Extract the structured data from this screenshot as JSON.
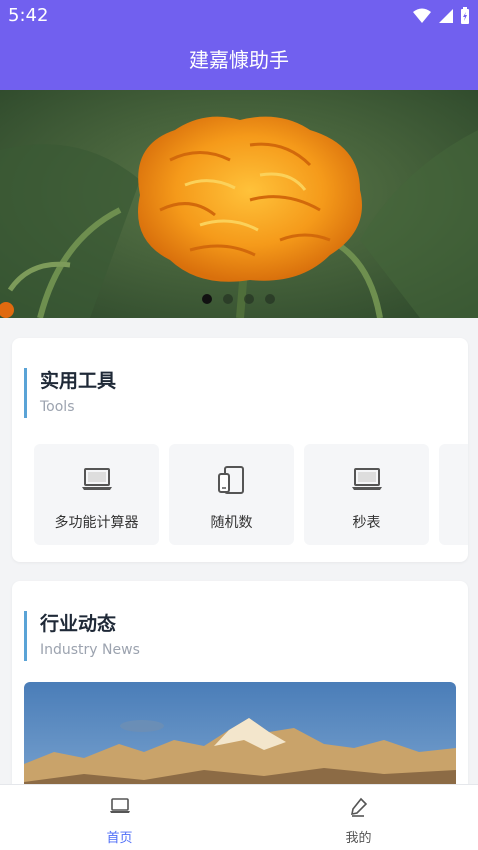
{
  "status_bar": {
    "time": "5:42"
  },
  "header": {
    "title": "建嘉慷助手"
  },
  "banner": {
    "slides": 4,
    "active_index": 0
  },
  "tools_section": {
    "title": "实用工具",
    "subtitle": "Tools",
    "items": [
      {
        "label": "多功能计算器",
        "icon": "laptop-icon"
      },
      {
        "label": "随机数",
        "icon": "devices-icon"
      },
      {
        "label": "秒表",
        "icon": "laptop-icon"
      }
    ]
  },
  "news_section": {
    "title": "行业动态",
    "subtitle": "Industry News"
  },
  "tabbar": {
    "items": [
      {
        "label": "首页",
        "icon": "laptop-icon",
        "active": true
      },
      {
        "label": "我的",
        "icon": "pen-icon",
        "active": false
      }
    ]
  },
  "colors": {
    "header_bg": "#7160ef",
    "accent_bar": "#5aa3d6",
    "tab_active": "#4f6ef7"
  }
}
